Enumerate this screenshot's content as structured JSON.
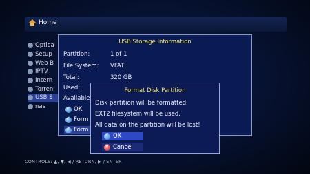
{
  "header": {
    "home_label": "Home"
  },
  "menu": {
    "items": [
      {
        "label": "Optica",
        "icon": "optical-disc-icon"
      },
      {
        "label": "Setup",
        "icon": "gear-icon"
      },
      {
        "label": "Web B",
        "icon": "globe-icon"
      },
      {
        "label": "IPTV",
        "icon": "tv-icon"
      },
      {
        "label": "Intern",
        "icon": "network-icon"
      },
      {
        "label": "Torren",
        "icon": "torrent-icon"
      },
      {
        "label": "USB S",
        "icon": "usb-icon"
      },
      {
        "label": "nas",
        "icon": "nas-icon"
      }
    ]
  },
  "info_panel": {
    "title": "USB Storage Information",
    "rows": [
      {
        "label": "Partition:",
        "value": "1 of 1"
      },
      {
        "label": "File System:",
        "value": "VFAT"
      },
      {
        "label": "Total:",
        "value": "320  GB"
      },
      {
        "label": "Used:",
        "value": ""
      },
      {
        "label": "Available",
        "value": ""
      }
    ],
    "buttons": [
      "OK",
      "Form",
      "Form"
    ]
  },
  "dialog": {
    "title": "Format Disk Partition",
    "lines": [
      "Disk partition will be formatted.",
      "EXT2 filesystem will be used.",
      "All data on the partition will be lost!"
    ],
    "ok_label": "OK",
    "cancel_label": "Cancel"
  },
  "footer": {
    "controls": "CONTROLS:  ▲, ▼, ◀ / RETURN, ▶ / ENTER"
  },
  "colors": {
    "accent": "#2f49c4",
    "title": "#f3e36a",
    "panel": "#0a1a52"
  }
}
